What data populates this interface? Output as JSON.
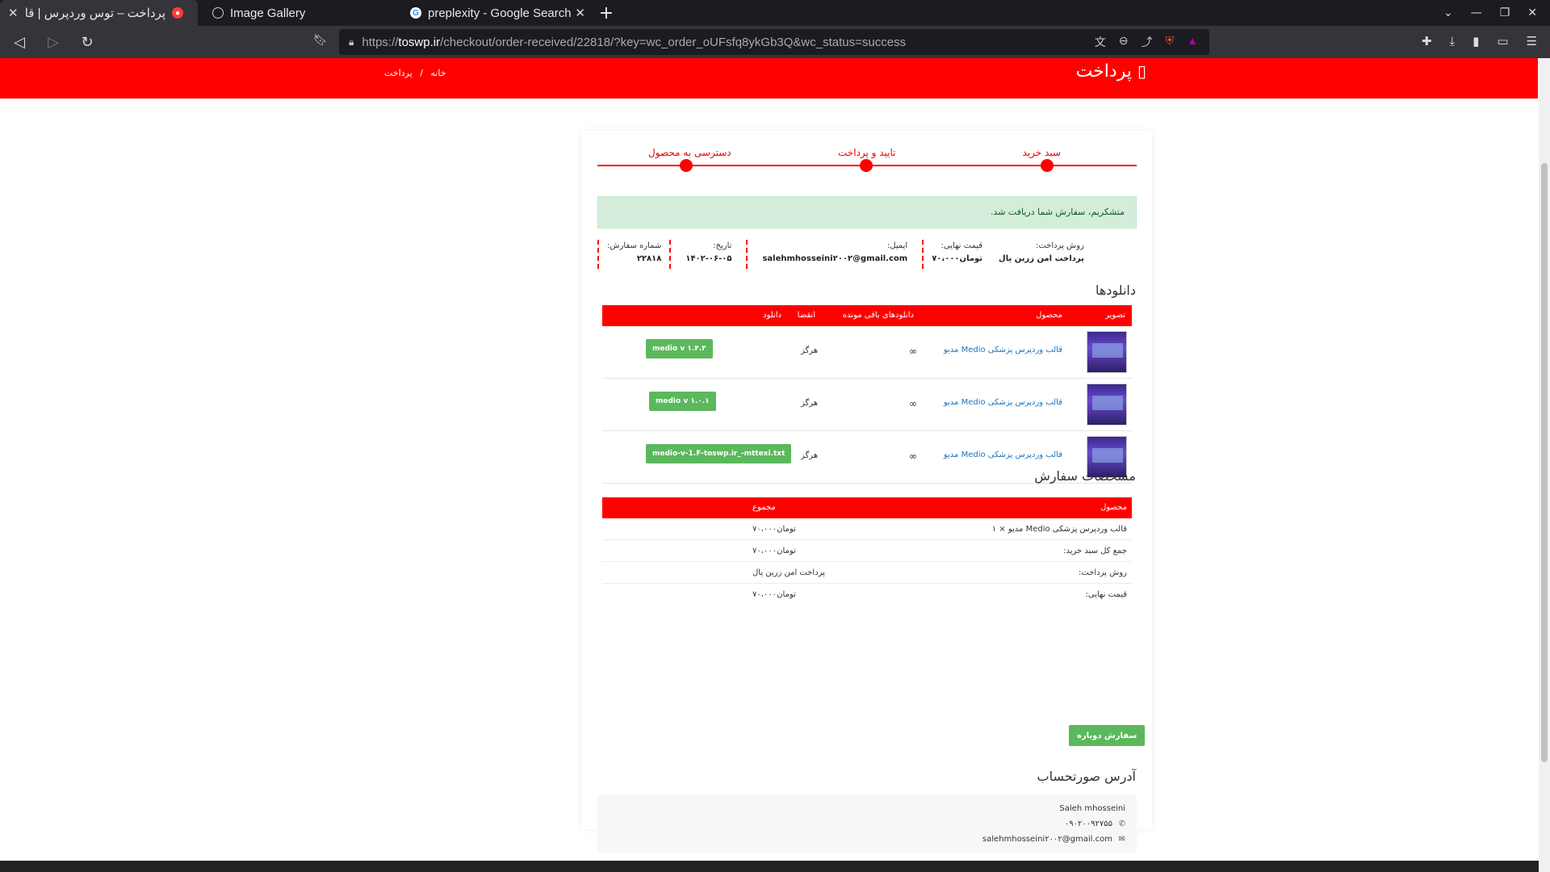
{
  "browser": {
    "tabs": [
      {
        "title": "پرداخت – توس وردپرس | قا",
        "active": true
      },
      {
        "title": "Image Gallery",
        "active": false
      },
      {
        "title": "preplexity - Google Search",
        "active": false
      }
    ],
    "url_prefix": "https://",
    "url_host": "toswp.ir",
    "url_path": "/checkout/order-received/22818/?key=wc_order_oUFsfq8ykGb3Q&wc_status=success"
  },
  "header": {
    "title": "پرداخت",
    "breadcrumb_home": "خانه",
    "breadcrumb_sep": "/",
    "breadcrumb_current": "پرداخت",
    "accent_color": "#ff0000"
  },
  "steps": [
    "سبد خرید",
    "تایید و پرداخت",
    "دسترسی به محصول"
  ],
  "notice": "متشکریم، سفارش شما دریافت شد.",
  "overview": {
    "order_label": "شماره سفارش:",
    "order_value": "۲۲۸۱۸",
    "date_label": "تاریخ:",
    "date_value": "۱۴۰۲-۰۶-۰۵",
    "email_label": "ایمیل:",
    "email_value": "salehmhosseini۲۰۰۲@gmail.com",
    "total_label": "قیمت نهایی:",
    "total_value": "تومان۷۰،۰۰۰",
    "method_label": "روش پرداخت:",
    "method_value": "پرداخت امن زرین پال"
  },
  "downloads": {
    "heading": "دانلودها",
    "columns": [
      "تصویر",
      "محصول",
      "دانلودهای باقی مونده",
      "انقضا",
      "دانلود"
    ],
    "rows": [
      {
        "product": "قالب وردپرس پزشکی Medio مدیو",
        "remaining": "∞",
        "expires": "هرگز",
        "file": "medio v ۱.۴.۳"
      },
      {
        "product": "قالب وردپرس پزشکی Medio مدیو",
        "remaining": "∞",
        "expires": "هرگز",
        "file": "medio v ۱.۰.۱"
      },
      {
        "product": "قالب وردپرس پزشکی Medio مدیو",
        "remaining": "∞",
        "expires": "هرگز",
        "file": "medio-v-1.F-toswp.ir_-mttexi.txt"
      }
    ]
  },
  "order_details": {
    "heading": "مشخصات سفارش",
    "col_product": "محصول",
    "col_total": "مجموع",
    "rows": [
      {
        "label": "قالب وردپرس پزشکی Medio مدیو × ۱",
        "value": "تومان۷۰،۰۰۰"
      },
      {
        "label": "جمع کل سبد خرید:",
        "value": "تومان۷۰،۰۰۰"
      },
      {
        "label": "روش پرداخت:",
        "value": "پرداخت امن زرین پال"
      },
      {
        "label": "قیمت نهایی:",
        "value": "تومان۷۰،۰۰۰"
      }
    ],
    "reorder_label": "سفارش دوباره"
  },
  "billing": {
    "heading": "آدرس صورتحساب",
    "name": "Saleh mhosseini",
    "phone": "۰۹۰۲۰۰۹۲۷۵۵",
    "email": "salehmhosseini۲۰۰۲@gmail.com"
  }
}
